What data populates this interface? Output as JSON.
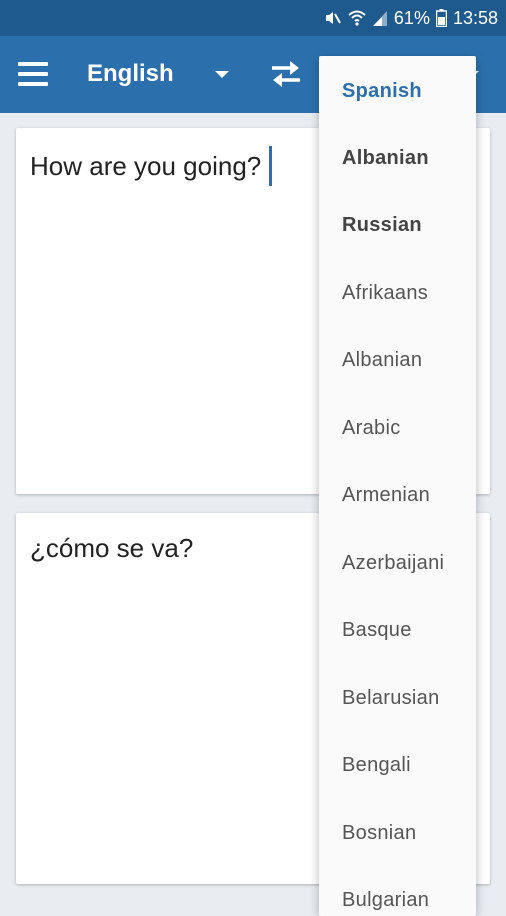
{
  "status_bar": {
    "battery_percent": "61%",
    "time": "13:58",
    "icons": [
      "mute-icon",
      "wifi-icon",
      "signal-icon",
      "battery-icon"
    ]
  },
  "toolbar": {
    "source_language": "English",
    "icons": [
      "menu-icon",
      "dropdown-caret-icon",
      "swap-icon"
    ]
  },
  "source_panel": {
    "text": "How are you going?"
  },
  "result_panel": {
    "text": "¿cómo se va?"
  },
  "language_menu": {
    "items": [
      {
        "label": "Spanish",
        "state": "selected"
      },
      {
        "label": "Albanian",
        "state": "recent"
      },
      {
        "label": "Russian",
        "state": "recent"
      },
      {
        "label": "Afrikaans",
        "state": "normal"
      },
      {
        "label": "Albanian",
        "state": "normal"
      },
      {
        "label": "Arabic",
        "state": "normal"
      },
      {
        "label": "Armenian",
        "state": "normal"
      },
      {
        "label": "Azerbaijani",
        "state": "normal"
      },
      {
        "label": "Basque",
        "state": "normal"
      },
      {
        "label": "Belarusian",
        "state": "normal"
      },
      {
        "label": "Bengali",
        "state": "normal"
      },
      {
        "label": "Bosnian",
        "state": "normal"
      },
      {
        "label": "Bulgarian",
        "state": "normal"
      }
    ]
  },
  "colors": {
    "status_bar": "#1f5a8f",
    "app_bar": "#2b70ad",
    "accent": "#2b70ad",
    "background": "#e9edf2"
  }
}
